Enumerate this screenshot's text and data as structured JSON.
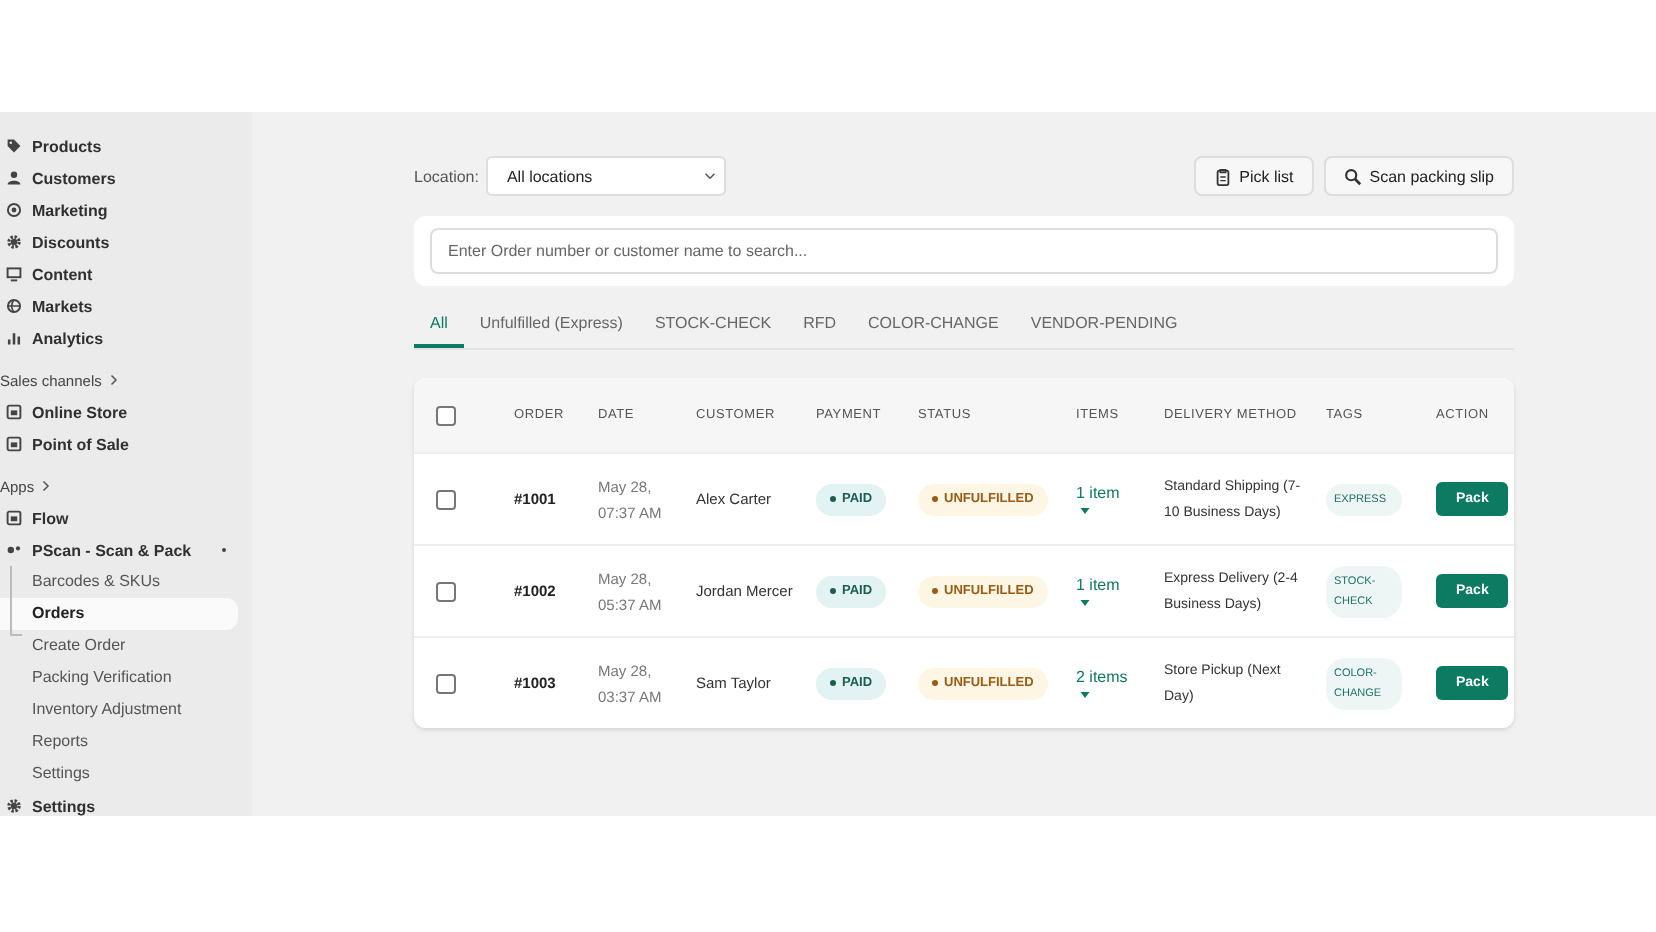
{
  "sidebar": {
    "items": [
      {
        "kind": "item",
        "label": "Products"
      },
      {
        "kind": "item",
        "label": "Customers"
      },
      {
        "kind": "item",
        "label": "Marketing"
      },
      {
        "kind": "item",
        "label": "Discounts"
      },
      {
        "kind": "item",
        "label": "Content"
      },
      {
        "kind": "item",
        "label": "Markets"
      },
      {
        "kind": "item",
        "label": "Analytics"
      },
      {
        "kind": "section",
        "label": "Sales channels"
      },
      {
        "kind": "item",
        "label": "Online Store"
      },
      {
        "kind": "item",
        "label": "Point of Sale"
      },
      {
        "kind": "section",
        "label": "Apps"
      },
      {
        "kind": "item",
        "label": "Flow"
      },
      {
        "kind": "item",
        "label": "PScan - Scan & Pack",
        "children": [
          {
            "label": "Barcodes & SKUs",
            "selected": false
          },
          {
            "label": "Orders",
            "selected": true
          },
          {
            "label": "Create Order",
            "selected": false
          },
          {
            "label": "Packing Verification",
            "selected": false
          },
          {
            "label": "Inventory Adjustment",
            "selected": false
          },
          {
            "label": "Reports",
            "selected": false
          },
          {
            "label": "Settings",
            "selected": false
          }
        ]
      },
      {
        "kind": "item",
        "label": "Settings"
      }
    ]
  },
  "toolbar": {
    "location_label": "Location:",
    "location_value": "All locations",
    "buttons": [
      {
        "label": "Pick list"
      },
      {
        "label": "Scan packing slip"
      }
    ]
  },
  "search": {
    "placeholder": "Enter Order number or customer name to search..."
  },
  "tabs": [
    {
      "label": "All",
      "selected": true
    },
    {
      "label": "Unfulfilled (Express)",
      "selected": false
    },
    {
      "label": "STOCK-CHECK",
      "selected": false
    },
    {
      "label": "RFD",
      "selected": false
    },
    {
      "label": "COLOR-CHANGE",
      "selected": false
    },
    {
      "label": "VENDOR-PENDING",
      "selected": false
    }
  ],
  "table": {
    "select_all_checked": false,
    "columns": [
      "ORDER",
      "DATE",
      "CUSTOMER",
      "PAYMENT",
      "STATUS",
      "ITEMS",
      "DELIVERY METHOD",
      "TAGS",
      "ACTION"
    ],
    "rows": [
      {
        "checked": false,
        "order": "#1001",
        "date": "May 28, 07:37 AM",
        "customer": "Alex Carter",
        "payment": "PAID",
        "status": "UNFULFILLED",
        "items": "1 item",
        "delivery": "Standard Shipping (7-10 Business Days)",
        "tag": "EXPRESS",
        "action": "Pack"
      },
      {
        "checked": false,
        "order": "#1002",
        "date": "May 28, 05:37 AM",
        "customer": "Jordan Mercer",
        "payment": "PAID",
        "status": "UNFULFILLED",
        "items": "1 item",
        "delivery": "Express Delivery (2-4 Business Days)",
        "tag": "STOCK-CHECK",
        "action": "Pack"
      },
      {
        "checked": false,
        "order": "#1003",
        "date": "May 28, 03:37 AM",
        "customer": "Sam Taylor",
        "payment": "PAID",
        "status": "UNFULFILLED",
        "items": "2 items",
        "delivery": "Store Pickup (Next Day)",
        "tag": "COLOR-CHANGE",
        "action": "Pack"
      }
    ]
  }
}
